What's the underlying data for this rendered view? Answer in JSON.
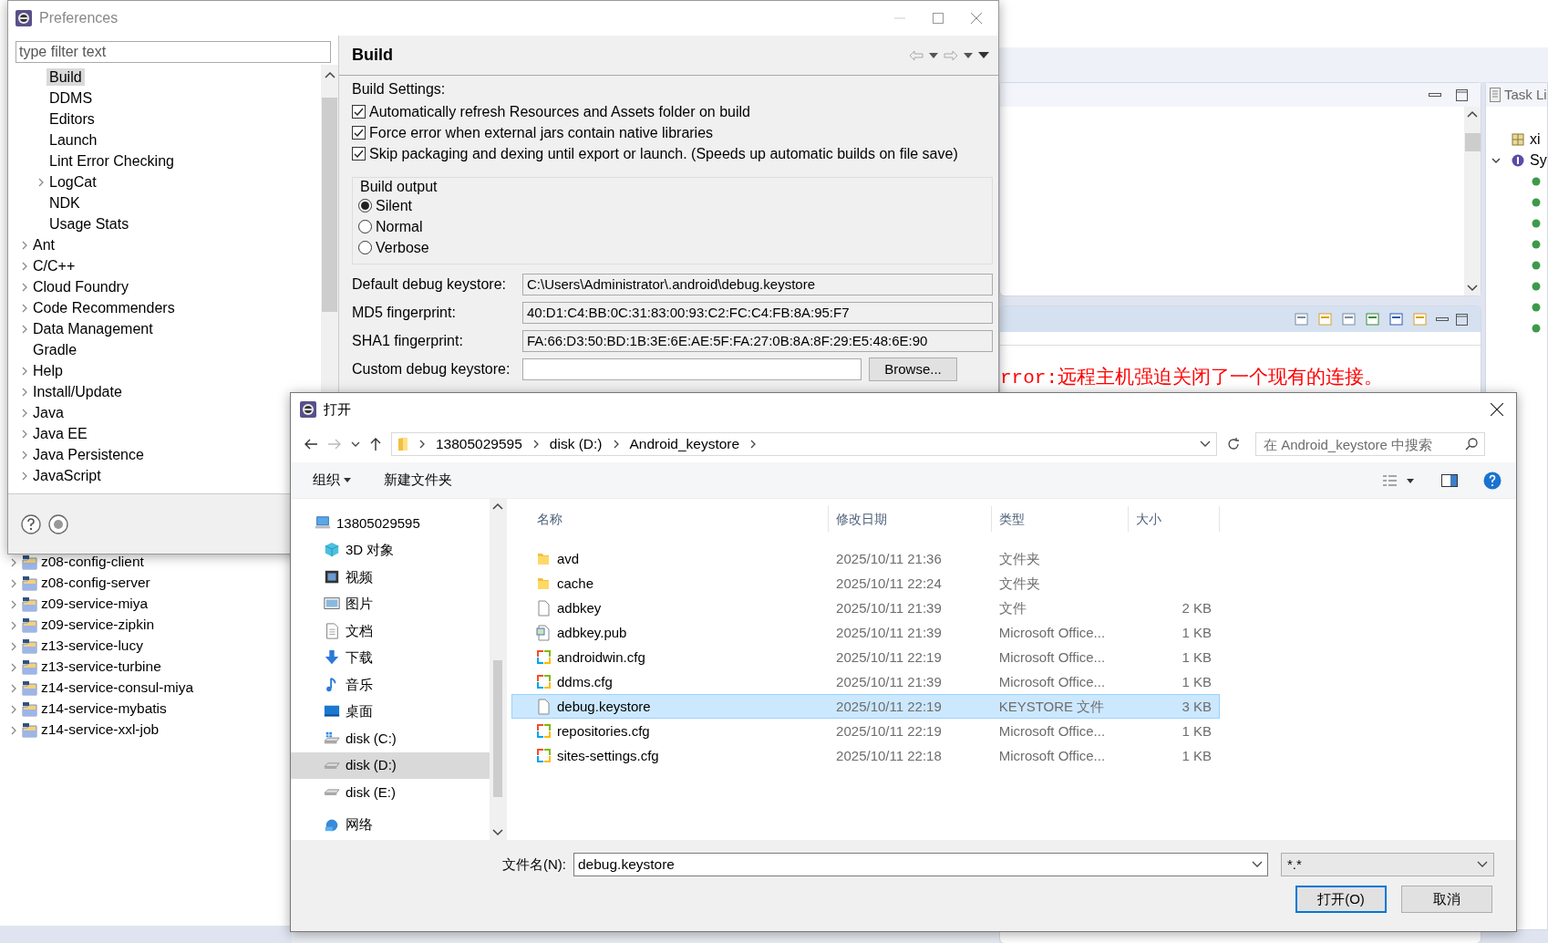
{
  "ide": {
    "projects": [
      "z08-config-client",
      "z08-config-server",
      "z09-service-miya",
      "z09-service-zipkin",
      "z13-service-lucy",
      "z13-service-turbine",
      "z14-service-consul-miya",
      "z14-service-mybatis",
      "z14-service-xxl-job"
    ],
    "console_error": "rror:远程主机强迫关闭了一个现有的连接。",
    "task_list": {
      "title": "Task Li",
      "items": [
        {
          "label": "xi",
          "kind": "package"
        },
        {
          "label": "Sy",
          "kind": "info",
          "expanded": true
        }
      ]
    }
  },
  "preferences": {
    "title": "Preferences",
    "filter_placeholder": "type filter text",
    "tree_continued": [
      {
        "label": "Build",
        "selected": true
      },
      {
        "label": "DDMS",
        "selected": false
      },
      {
        "label": "Editors",
        "selected": false
      },
      {
        "label": "Launch",
        "selected": false
      },
      {
        "label": "Lint Error Checking",
        "selected": false
      },
      {
        "label": "LogCat",
        "selected": false,
        "expanded": false
      },
      {
        "label": "NDK",
        "selected": false
      },
      {
        "label": "Usage Stats",
        "selected": false
      }
    ],
    "tree": [
      {
        "label": "Ant",
        "selected": false,
        "expanded": false
      },
      {
        "label": "C/C++",
        "selected": false,
        "expanded": false
      },
      {
        "label": "Cloud Foundry",
        "selected": false,
        "expanded": false
      },
      {
        "label": "Code Recommenders",
        "selected": false,
        "expanded": false
      },
      {
        "label": "Data Management",
        "selected": false,
        "expanded": false
      },
      {
        "label": "Gradle",
        "selected": false
      },
      {
        "label": "Help",
        "selected": false,
        "expanded": false
      },
      {
        "label": "Install/Update",
        "selected": false,
        "expanded": false
      },
      {
        "label": "Java",
        "selected": false,
        "expanded": false
      },
      {
        "label": "Java EE",
        "selected": false,
        "expanded": false
      },
      {
        "label": "Java Persistence",
        "selected": false,
        "expanded": false
      },
      {
        "label": "JavaScript",
        "selected": false,
        "expanded": false
      }
    ],
    "page": {
      "title": "Build",
      "settings_label": "Build Settings:",
      "checkboxes": [
        {
          "label": "Automatically refresh Resources and Assets folder on build",
          "checked": true
        },
        {
          "label": "Force error when external jars contain native libraries",
          "checked": true
        },
        {
          "label": "Skip packaging and dexing until export or launch. (Speeds up automatic builds on file save)",
          "checked": true
        }
      ],
      "output": {
        "label": "Build output",
        "options": [
          {
            "label": "Silent",
            "selected": true
          },
          {
            "label": "Normal",
            "selected": false
          },
          {
            "label": "Verbose",
            "selected": false
          }
        ]
      },
      "fields": [
        {
          "label": "Default debug keystore:",
          "value": "C:\\Users\\Administrator\\.android\\debug.keystore",
          "kind": "readonly"
        },
        {
          "label": "MD5 fingerprint:",
          "value": "40:D1:C4:BB:0C:31:83:00:93:C2:FC:C4:FB:8A:95:F7",
          "kind": "readonly"
        },
        {
          "label": "SHA1 fingerprint:",
          "value": "FA:66:D3:50:BD:1B:3E:6E:AE:5F:FA:27:0B:8A:8F:29:E5:48:6E:90",
          "kind": "readonly"
        },
        {
          "label": "Custom debug keystore:",
          "kind": "browse",
          "button": "Browse..."
        }
      ]
    }
  },
  "open_dialog": {
    "title": "打开",
    "path": [
      "13805029595",
      "disk (D:)",
      "Android_keystore"
    ],
    "search_placeholder": "在 Android_keystore 中搜索",
    "toolbar": [
      {
        "label": "组织",
        "dropdown": true
      },
      {
        "label": "新建文件夹",
        "dropdown": false
      }
    ],
    "nav": [
      {
        "label": "13805029595",
        "kind": "computer",
        "selected": false
      },
      {
        "label": "3D 对象",
        "kind": "object3d",
        "selected": false
      },
      {
        "label": "视频",
        "kind": "video",
        "selected": false
      },
      {
        "label": "图片",
        "kind": "pictures",
        "selected": false
      },
      {
        "label": "文档",
        "kind": "documents",
        "selected": false
      },
      {
        "label": "下载",
        "kind": "downloads",
        "selected": false
      },
      {
        "label": "音乐",
        "kind": "music",
        "selected": false
      },
      {
        "label": "桌面",
        "kind": "desktop",
        "selected": false
      },
      {
        "label": "disk (C:)",
        "kind": "system_drive",
        "selected": false
      },
      {
        "label": "disk (D:)",
        "kind": "drive",
        "selected": true
      },
      {
        "label": "disk (E:)",
        "kind": "drive",
        "selected": false
      },
      {
        "label": "网络",
        "kind": "network",
        "selected": false
      }
    ],
    "columns": [
      "名称",
      "修改日期",
      "类型",
      "大小"
    ],
    "files": [
      {
        "name": "avd",
        "date": "2025/10/11 21:36",
        "type": "文件夹",
        "kind": "folder",
        "selected": false
      },
      {
        "name": "cache",
        "date": "2025/10/11 22:24",
        "type": "文件夹",
        "kind": "folder",
        "selected": false
      },
      {
        "name": "adbkey",
        "date": "2025/10/11 21:39",
        "type": "文件",
        "size": "2 KB",
        "kind": "file",
        "selected": false
      },
      {
        "name": "adbkey.pub",
        "date": "2025/10/11 21:39",
        "type": "Microsoft Office...",
        "size": "1 KB",
        "kind": "pub",
        "selected": false
      },
      {
        "name": "androidwin.cfg",
        "date": "2025/10/11 22:19",
        "type": "Microsoft Office...",
        "size": "1 KB",
        "kind": "cfg",
        "selected": false
      },
      {
        "name": "ddms.cfg",
        "date": "2025/10/11 21:39",
        "type": "Microsoft Office...",
        "size": "1 KB",
        "kind": "cfg",
        "selected": false
      },
      {
        "name": "debug.keystore",
        "date": "2025/10/11 22:19",
        "type": "KEYSTORE 文件",
        "size": "3 KB",
        "kind": "file",
        "selected": true
      },
      {
        "name": "repositories.cfg",
        "date": "2025/10/11 22:19",
        "type": "Microsoft Office...",
        "size": "1 KB",
        "kind": "cfg",
        "selected": false
      },
      {
        "name": "sites-settings.cfg",
        "date": "2025/10/11 22:18",
        "type": "Microsoft Office...",
        "size": "1 KB",
        "kind": "cfg",
        "selected": false
      }
    ],
    "file_name_label": "文件名(N):",
    "file_name": "debug.keystore",
    "file_type": "*.*",
    "buttons": [
      {
        "label": "打开(O)",
        "primary": true
      },
      {
        "label": "取消",
        "primary": false
      }
    ]
  }
}
